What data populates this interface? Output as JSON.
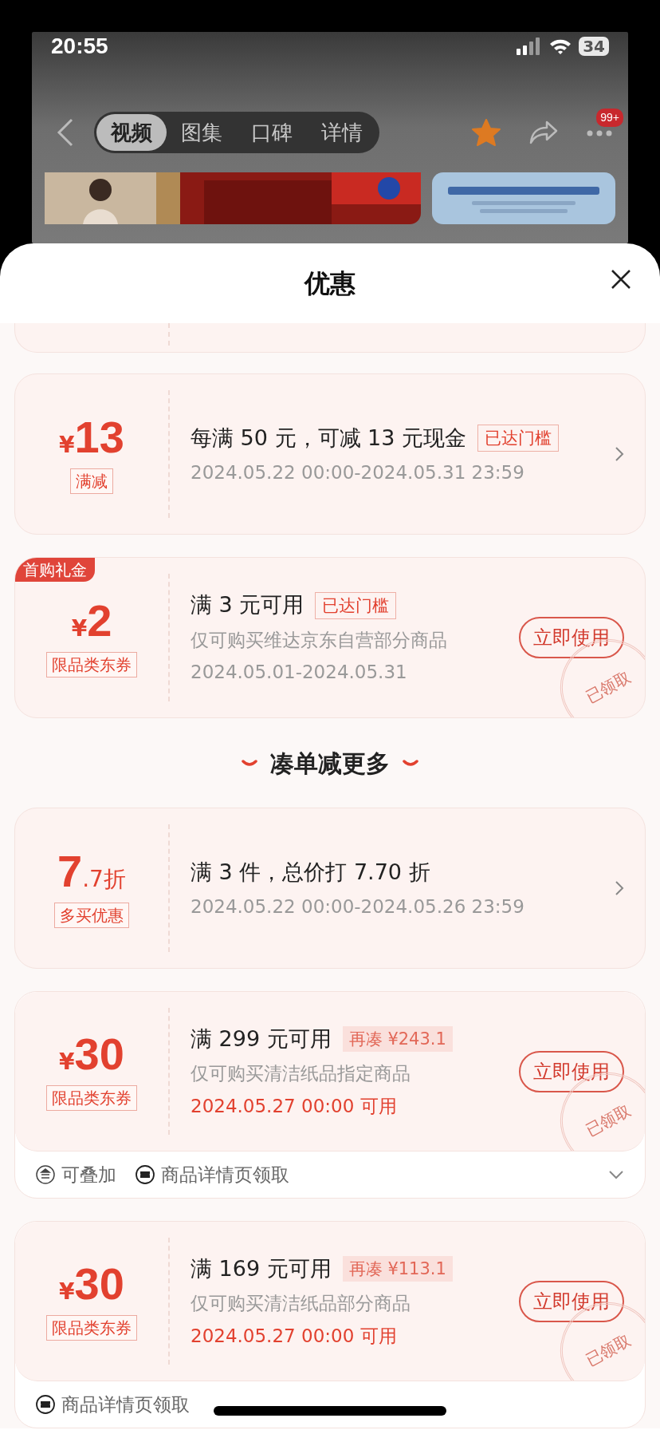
{
  "status_bar": {
    "time": "20:55",
    "battery": "34"
  },
  "nav": {
    "tabs": [
      {
        "label": "视频",
        "selected": true
      },
      {
        "label": "图集",
        "selected": false
      },
      {
        "label": "口碑",
        "selected": false
      },
      {
        "label": "详情",
        "selected": false
      }
    ],
    "more_badge": "99+"
  },
  "sheet": {
    "title": "优惠"
  },
  "groups": [
    {
      "coupons": [
        {
          "kind": "partial"
        },
        {
          "kind": "amount",
          "currency": "¥",
          "value": "13",
          "type_label": "满减",
          "title": "每满 50 元，可减 13 元现金",
          "threshold": {
            "text": "已达门槛",
            "kind": "met"
          },
          "lines": [
            {
              "text": "2024.05.22 00:00-2024.05.31 23:59",
              "highlight": false
            }
          ],
          "action": {
            "kind": "arrow"
          }
        },
        {
          "kind": "amount",
          "corner_tag": "首购礼金",
          "currency": "¥",
          "value": "2",
          "type_label": "限品类东券",
          "title": "满 3 元可用",
          "threshold": {
            "text": "已达门槛",
            "kind": "met"
          },
          "lines": [
            {
              "text": "仅可购买维达京东自营部分商品",
              "highlight": false
            },
            {
              "text": "2024.05.01-2024.05.31",
              "highlight": false
            }
          ],
          "action": {
            "kind": "button",
            "label": "立即使用"
          },
          "stamp": "已领取"
        }
      ]
    },
    {
      "heading": "凑单减更多",
      "coupons": [
        {
          "kind": "discount",
          "value": "7",
          "suffix": ".7折",
          "type_label": "多买优惠",
          "title": "满 3 件，总价打 7.70 折",
          "lines": [
            {
              "text": "2024.05.22 00:00-2024.05.26 23:59",
              "highlight": false
            }
          ],
          "action": {
            "kind": "arrow"
          }
        },
        {
          "kind": "amount",
          "currency": "¥",
          "value": "30",
          "type_label": "限品类东券",
          "title": "满 299 元可用",
          "threshold": {
            "text": "再凑 ¥243.1",
            "kind": "gap"
          },
          "lines": [
            {
              "text": "仅可购买清洁纸品指定商品",
              "highlight": false
            },
            {
              "text": "2024.05.27 00:00 可用",
              "highlight": true
            }
          ],
          "action": {
            "kind": "button",
            "label": "立即使用"
          },
          "stamp": "已领取",
          "footer": {
            "items": [
              {
                "kind": "stack",
                "text": "可叠加"
              },
              {
                "kind": "ticket",
                "text": "商品详情页领取"
              }
            ],
            "expand": true
          }
        },
        {
          "kind": "amount",
          "currency": "¥",
          "value": "30",
          "type_label": "限品类东券",
          "title": "满 169 元可用",
          "threshold": {
            "text": "再凑 ¥113.1",
            "kind": "gap"
          },
          "lines": [
            {
              "text": "仅可购买清洁纸品部分商品",
              "highlight": false
            },
            {
              "text": "2024.05.27 00:00 可用",
              "highlight": true
            }
          ],
          "action": {
            "kind": "button",
            "label": "立即使用"
          },
          "stamp": "已领取",
          "footer": {
            "items": [
              {
                "kind": "ticket",
                "text": "商品详情页领取"
              }
            ]
          }
        }
      ]
    }
  ]
}
